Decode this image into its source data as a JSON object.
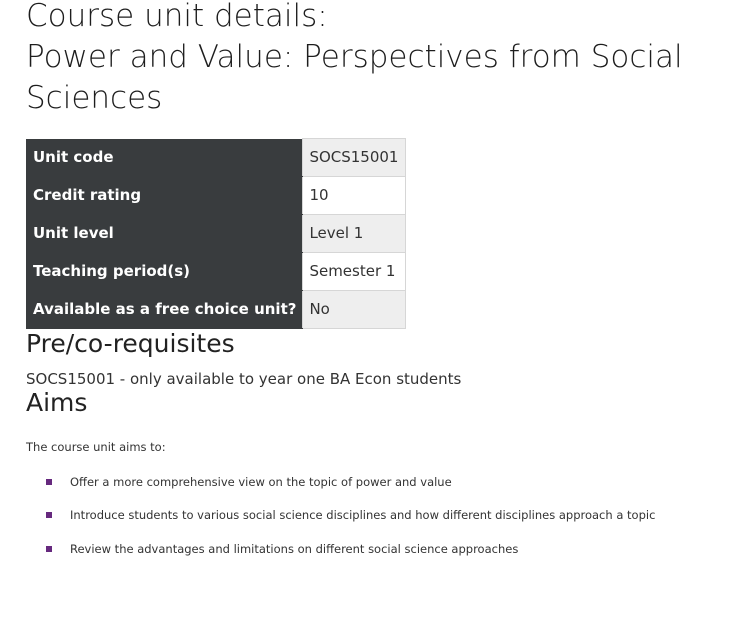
{
  "page_title": {
    "line1": "Course unit details:",
    "line2": "Power and Value: Perspectives from Social",
    "line3": "Sciences"
  },
  "details_table": {
    "rows": [
      {
        "label": "Unit code",
        "value": "SOCS15001"
      },
      {
        "label": "Credit rating",
        "value": "10"
      },
      {
        "label": "Unit level",
        "value": "Level 1"
      },
      {
        "label": "Teaching period(s)",
        "value": "Semester 1"
      },
      {
        "label": "Available as a free choice unit?",
        "value": "No"
      }
    ]
  },
  "prerequisites": {
    "heading": "Pre/co-requisites",
    "text": "SOCS15001 - only available to year one BA Econ students"
  },
  "aims": {
    "heading": "Aims",
    "intro": "The course unit aims to:",
    "items": [
      "Offer a more comprehensive view on the topic of power and value",
      "Introduce students to various social science disciplines and how different disciplines approach a topic",
      "Review the advantages and limitations on different social science approaches"
    ],
    "bullet_color": "#66297e"
  },
  "colors": {
    "table_header_bg": "#393c3e",
    "table_odd_row_bg": "#eeeeee"
  }
}
